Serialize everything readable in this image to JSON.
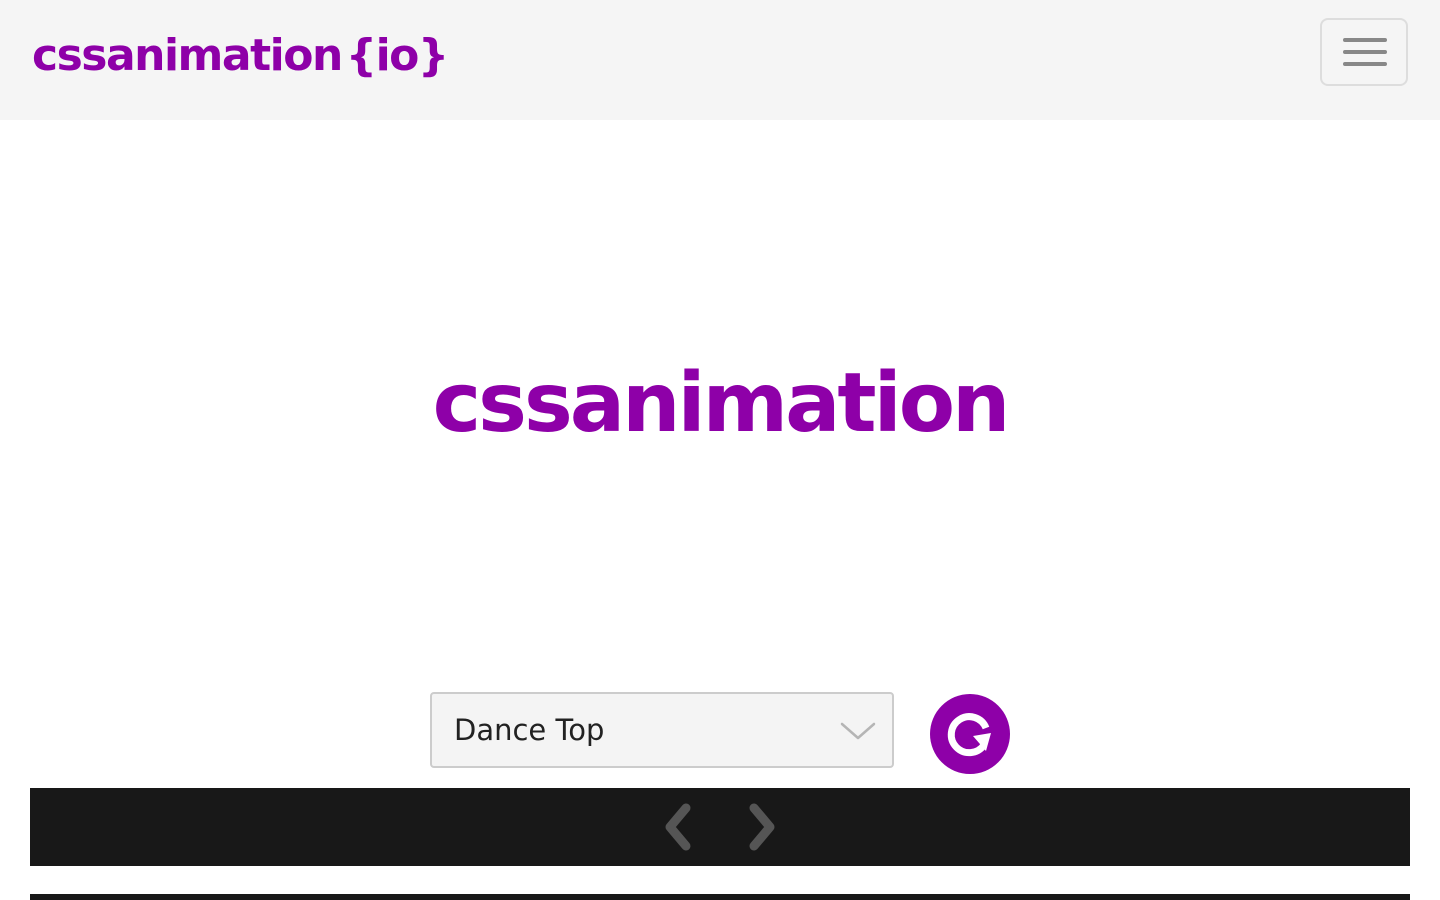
{
  "header": {
    "brand_name": "cssanimation",
    "brand_suffix": "{io}",
    "menu_icon": "hamburger-icon"
  },
  "stage": {
    "animated_text": "cssanimation"
  },
  "controls": {
    "animation_select": {
      "selected": "Dance Top",
      "icon": "chevron-down-icon"
    },
    "replay_icon": "replay-icon"
  },
  "nav": {
    "prev_icon": "chevron-left-icon",
    "next_icon": "chevron-right-icon"
  },
  "colors": {
    "brand": "#8e00a8",
    "navbar_bg": "#f5f5f5",
    "strip_bg": "#181818",
    "arrow": "#555555"
  }
}
